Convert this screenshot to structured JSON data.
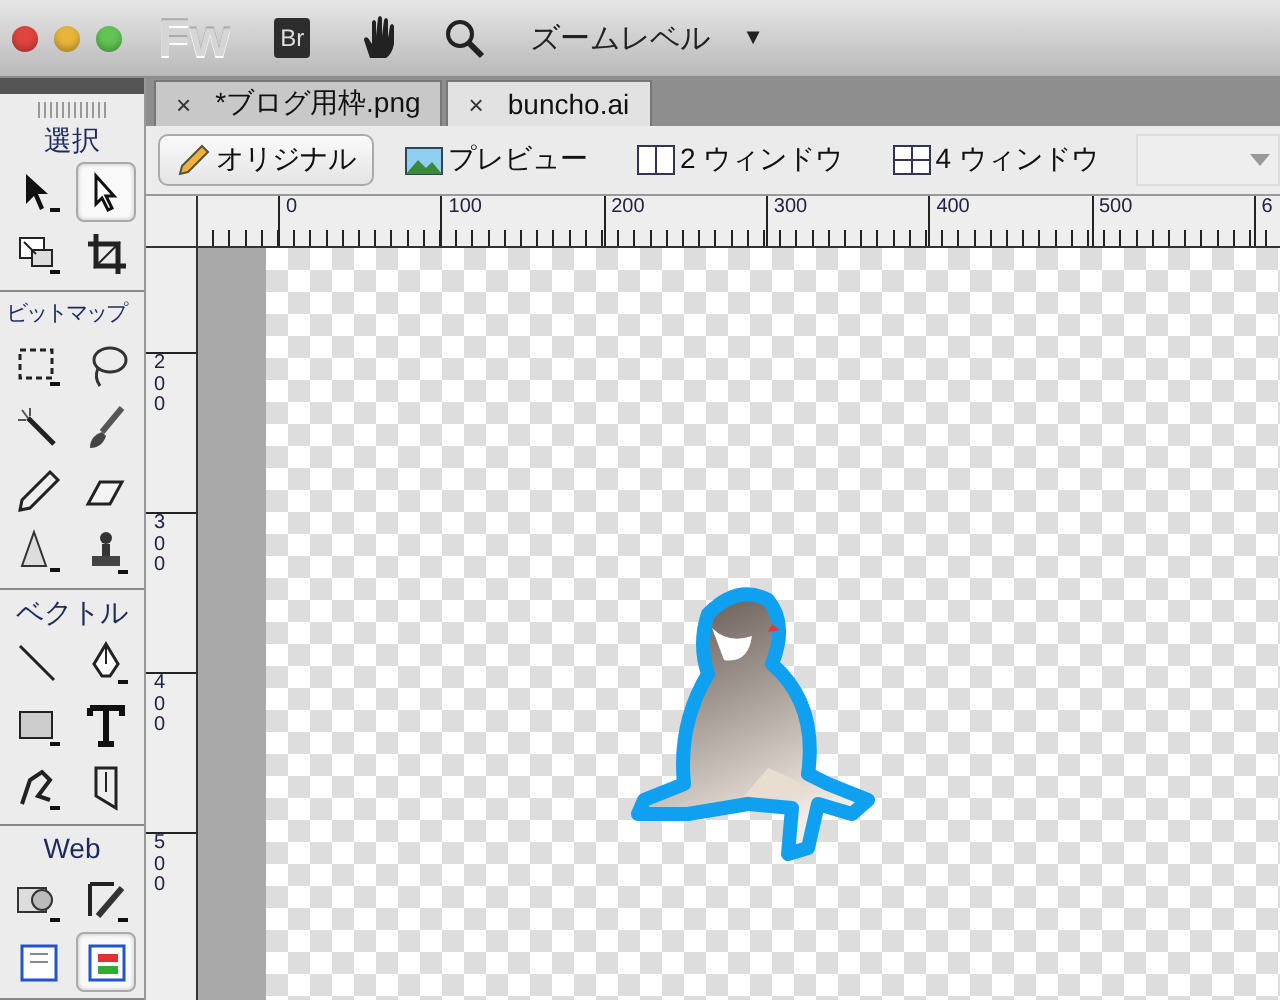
{
  "title_bar": {
    "app_logo": "Fw",
    "bridge_logo": "Br",
    "zoom_label": "ズームレベル",
    "zoom_caret": "▼"
  },
  "tool_panel": {
    "sections": [
      {
        "title": "選択",
        "tools": [
          {
            "kind": "pointer",
            "selected": false
          },
          {
            "kind": "subselect",
            "selected": true
          },
          {
            "kind": "scale",
            "selected": false
          },
          {
            "kind": "crop",
            "selected": false
          }
        ]
      },
      {
        "title": "ビットマップ",
        "tools": [
          {
            "kind": "marquee",
            "selected": false
          },
          {
            "kind": "lasso",
            "selected": false
          },
          {
            "kind": "wand",
            "selected": false
          },
          {
            "kind": "brush",
            "selected": false
          },
          {
            "kind": "pencil",
            "selected": false
          },
          {
            "kind": "eraser",
            "selected": false
          },
          {
            "kind": "blur",
            "selected": false
          },
          {
            "kind": "stamp",
            "selected": false
          }
        ]
      },
      {
        "title": "ベクトル",
        "tools": [
          {
            "kind": "line",
            "selected": false
          },
          {
            "kind": "pen",
            "selected": false
          },
          {
            "kind": "rect",
            "selected": false
          },
          {
            "kind": "text",
            "selected": false
          },
          {
            "kind": "freeform",
            "selected": false
          },
          {
            "kind": "knife",
            "selected": false
          }
        ]
      },
      {
        "title": "Web",
        "tools": [
          {
            "kind": "hotspot",
            "selected": false
          },
          {
            "kind": "slice",
            "selected": false
          },
          {
            "kind": "hide-slices",
            "selected": false
          },
          {
            "kind": "show-slices",
            "selected": true
          }
        ]
      }
    ]
  },
  "tabs": [
    {
      "close": "×",
      "label": "*ブログ用枠.png",
      "selected": false
    },
    {
      "close": "×",
      "label": "buncho.ai",
      "selected": true
    }
  ],
  "view_buttons": [
    {
      "kind": "original",
      "label": "オリジナル",
      "selected": true
    },
    {
      "kind": "preview",
      "label": "プレビュー",
      "selected": false
    },
    {
      "kind": "two",
      "label": "2 ウィンドウ",
      "selected": false
    },
    {
      "kind": "four",
      "label": "4 ウィンドウ",
      "selected": false
    }
  ],
  "top_ruler": [
    "0",
    "100",
    "200",
    "300",
    "400",
    "500",
    "6"
  ],
  "left_ruler": [
    "200",
    "300",
    "400",
    "500"
  ]
}
